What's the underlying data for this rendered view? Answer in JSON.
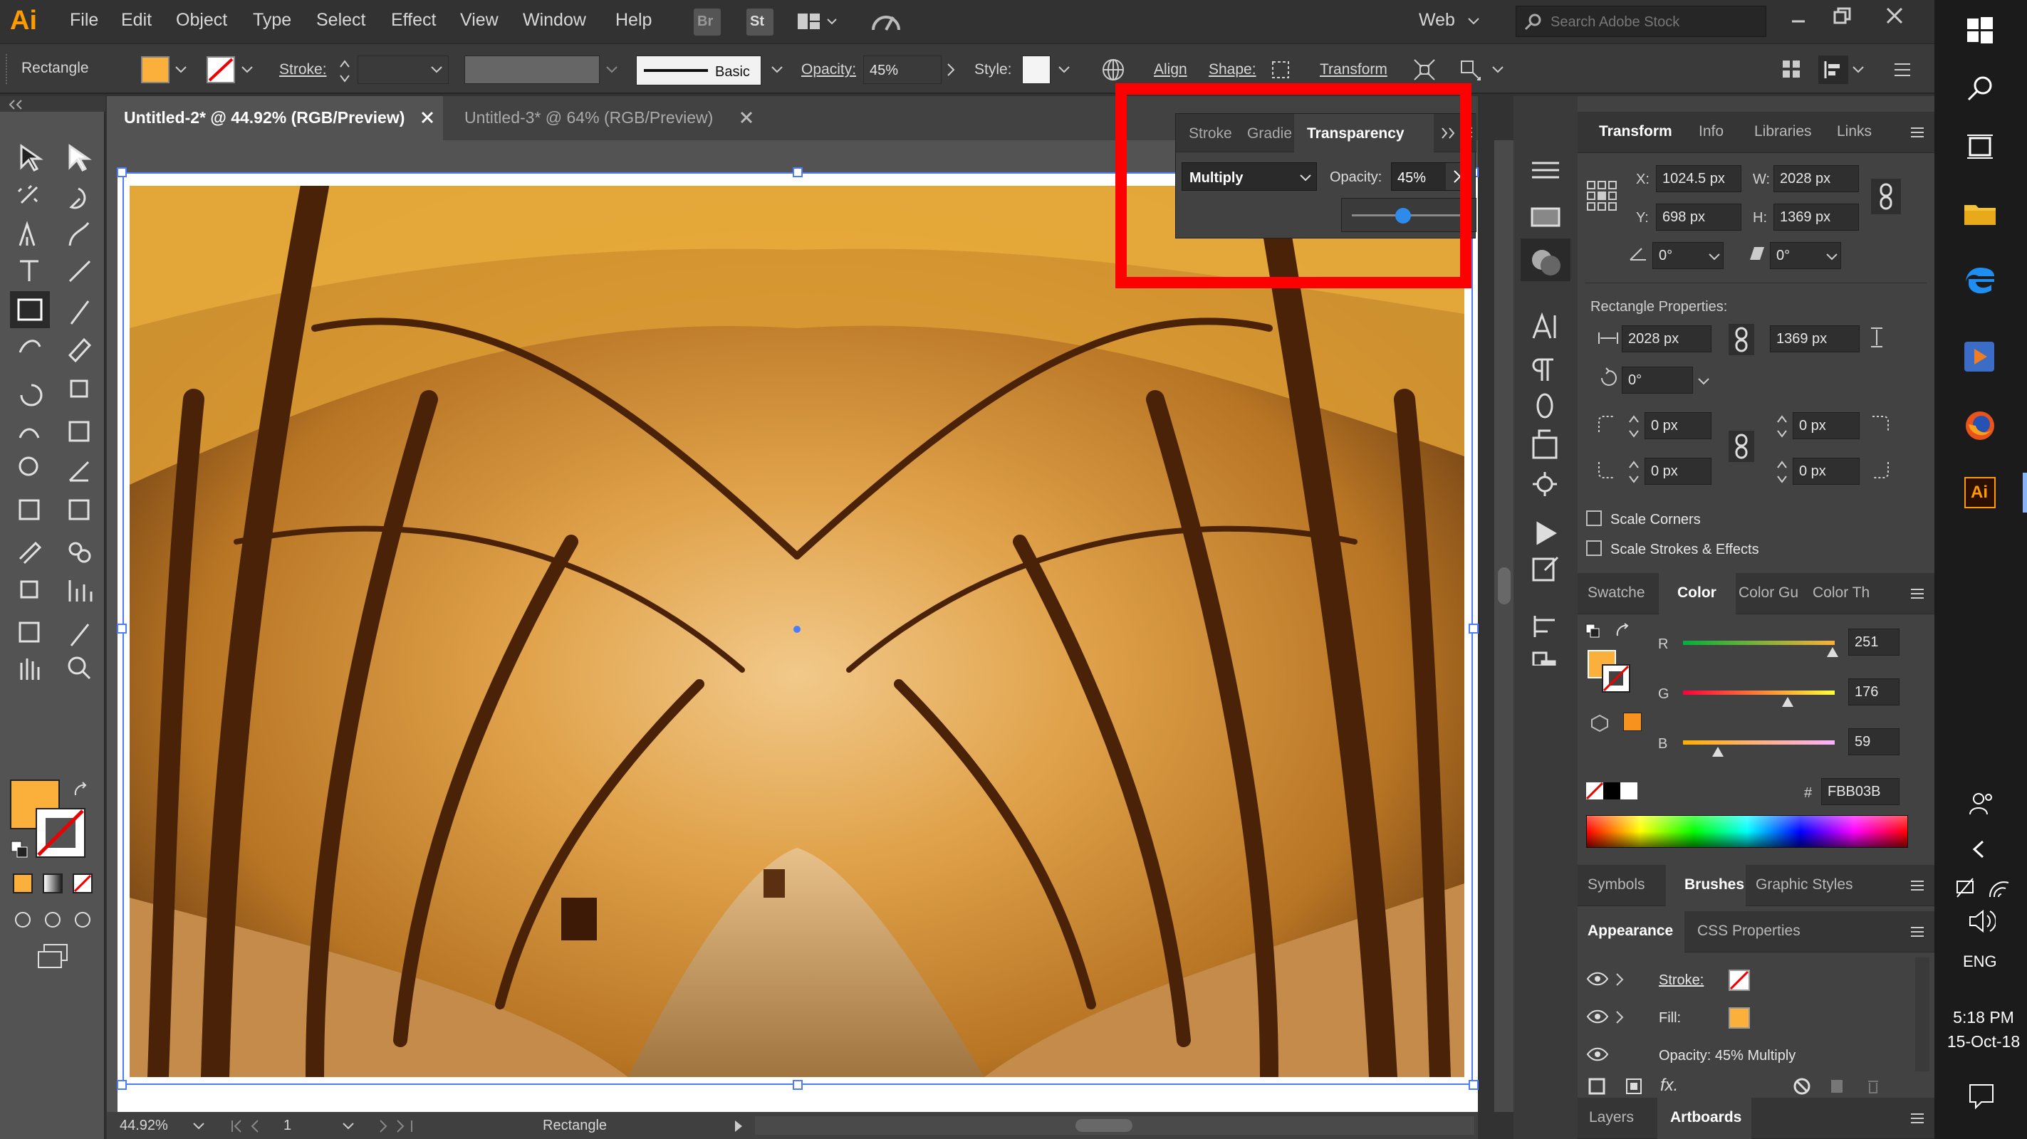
{
  "app": {
    "logo": "Ai",
    "workspace": "Web",
    "search_placeholder": "Search Adobe Stock",
    "bridge": "Br",
    "stock": "St"
  },
  "menu": [
    "File",
    "Edit",
    "Object",
    "Type",
    "Select",
    "Effect",
    "View",
    "Window",
    "Help"
  ],
  "control": {
    "object_type": "Rectangle",
    "stroke_label": "Stroke:",
    "brush_label": "Basic",
    "opacity_label": "Opacity:",
    "opacity_value": "45%",
    "style_label": "Style:",
    "align_label": "Align",
    "shape_label": "Shape:",
    "transform_label": "Transform",
    "fill_color": "#FBB03B"
  },
  "tabs": [
    {
      "title": "Untitled-2* @ 44.92% (RGB/Preview)",
      "active": true
    },
    {
      "title": "Untitled-3* @ 64% (RGB/Preview)",
      "active": false
    }
  ],
  "transparency": {
    "tabs": [
      "Stroke",
      "Gradie",
      "Transparency"
    ],
    "blend_mode": "Multiply",
    "opacity_label": "Opacity:",
    "opacity_value": "45%",
    "slider_fraction": 0.45,
    "highlight_color": "#FF0000"
  },
  "transform_panel": {
    "tabs": [
      "Transform",
      "Info",
      "Libraries",
      "Links"
    ],
    "x": "1024.5 px",
    "y": "698 px",
    "w": "2028 px",
    "h": "1369 px",
    "x_label": "X:",
    "y_label": "Y:",
    "w_label": "W:",
    "h_label": "H:",
    "rotate": "0°",
    "shear": "0°",
    "rect_props_label": "Rectangle Properties:",
    "rect_w": "2028 px",
    "rect_h": "1369 px",
    "rect_rotate": "0°",
    "corner_tl": "0 px",
    "corner_tr": "0 px",
    "corner_bl": "0 px",
    "corner_br": "0 px",
    "scale_corners": "Scale Corners",
    "scale_strokes": "Scale Strokes & Effects"
  },
  "color_panel": {
    "tabs": [
      "Swatche",
      "Color",
      "Color Gu",
      "Color Th"
    ],
    "r_label": "R",
    "g_label": "G",
    "b_label": "B",
    "r": "251",
    "g": "176",
    "b": "59",
    "hash": "#",
    "hex": "FBB03B"
  },
  "lower_panels": {
    "tabs_a": [
      "Symbols",
      "Brushes",
      "Graphic Styles"
    ],
    "tabs_b": [
      "Appearance",
      "CSS Properties"
    ],
    "stroke_label": "Stroke:",
    "fill_label": "Fill:",
    "opacity_row": "Opacity: 45% Multiply",
    "fx": "fx.",
    "tabs_c": [
      "Layers",
      "Artboards"
    ]
  },
  "status": {
    "zoom": "44.92%",
    "artboard": "1",
    "tool": "Rectangle"
  },
  "system": {
    "lang": "ENG",
    "time": "5:18 PM",
    "date": "15-Oct-18"
  }
}
